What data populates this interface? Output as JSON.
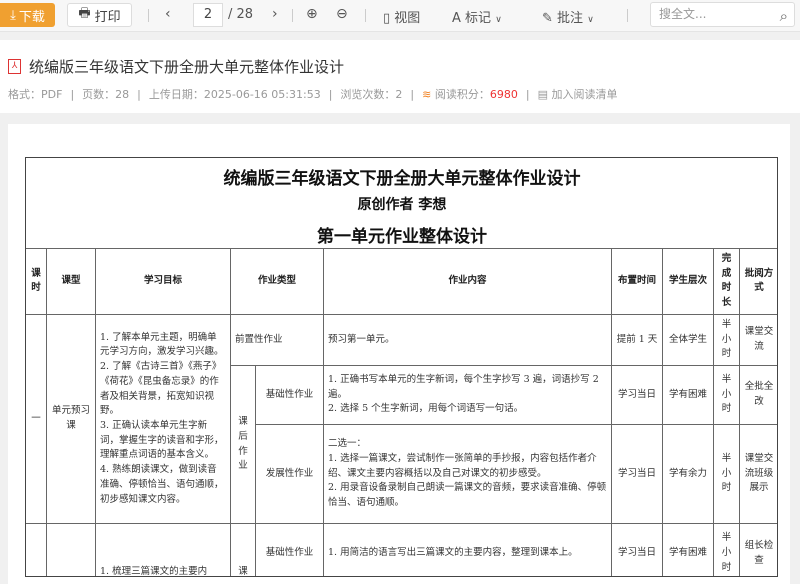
{
  "toolbar": {
    "download": "下载",
    "print": "打印",
    "page_current": "2",
    "page_total": "/ 28",
    "view": "视图",
    "mark": "标记",
    "annotate": "批注",
    "search_placeholder": "搜全文..."
  },
  "doc": {
    "title": "统编版三年级语文下册全册大单元整体作业设计",
    "meta": {
      "format": "格式：PDF",
      "pages": "页数：28",
      "upload": "上传日期：2025-06-16 05:31:53",
      "views": "浏览次数：2",
      "points_label": "阅读积分：",
      "points": "6980",
      "add_list": "加入阅读清单"
    }
  },
  "page": {
    "title": "统编版三年级语文下册全册大单元整体作业设计",
    "author": "原创作者  李想",
    "subtitle": "第一单元作业整体设计",
    "headers": [
      "课时",
      "课型",
      "学习目标",
      "作业类型",
      "作业内容",
      "布置时间",
      "学生层次",
      "完成时长",
      "批阅方式"
    ],
    "lesson1": {
      "num": "一",
      "type": "单元预习课",
      "goals": "1. 了解本单元主题，明确单元学习方向，激发学习兴趣。\n2. 了解《古诗三首》《燕子》《荷花》《昆虫备忘录》的作者及相关背景，拓宽知识视野。\n3. 正确认读本单元生字新词，掌握生字的读音和字形，理解重点词语的基本含义。\n4. 熟练朗读课文，做到读音准确、停顿恰当、语句通顺，初步感知课文内容。",
      "after": "课后作业",
      "rows": [
        {
          "kind": "前置性作业",
          "content": "预习第一单元。",
          "time": "提前 1 天",
          "level": "全体学生",
          "duration": "半小时",
          "review": "课堂交流"
        },
        {
          "kind": "基础性作业",
          "content": "1. 正确书写本单元的生字新词，每个生字抄写 3 遍，词语抄写 2 遍。\n2. 选择 5 个生字新词，用每个词语写一句话。",
          "time": "学习当日",
          "level": "学有困难",
          "duration": "半小时",
          "review": "全批全改"
        },
        {
          "kind": "发展性作业",
          "content": "二选一：\n1. 选择一篇课文，尝试制作一张简单的手抄报，内容包括作者介绍、课文主要内容概括以及自己对课文的初步感受。\n2. 用录音设备录制自己朗读一篇课文的音频，要求读音准确、停顿恰当、语句通顺。",
          "time": "学习当日",
          "level": "学有余力",
          "duration": "半小时",
          "review": "课堂交流班级展示"
        }
      ]
    },
    "lesson2": {
      "goals": "1. 梳理三篇课文的主要内",
      "after": "课",
      "kind": "基础性作业",
      "content": "1. 用简洁的语言写出三篇课文的主要内容，整理到课本上。",
      "time": "学习当日",
      "level": "学有困难",
      "duration": "半小时",
      "review": "组长检查"
    }
  }
}
